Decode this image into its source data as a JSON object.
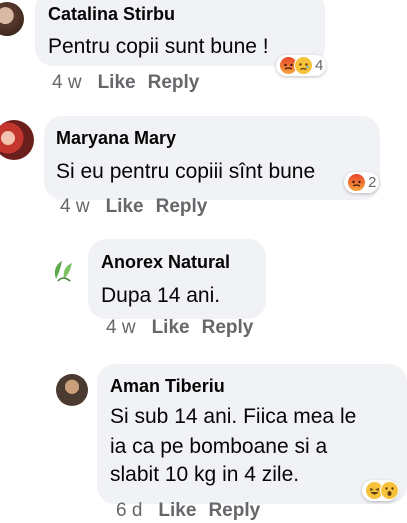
{
  "comments": [
    {
      "author": "Catalina Stirbu",
      "text_lines": [
        "Pentru copii sunt bune !"
      ],
      "time": "4 w",
      "like_label": "Like",
      "reply_label": "Reply",
      "reactions": {
        "icons": [
          "angry-icon",
          "sad-icon"
        ],
        "count": "4"
      }
    },
    {
      "author": "Maryana Mary",
      "text_lines": [
        "Si eu pentru copiii sînt bune"
      ],
      "time": "4 w",
      "like_label": "Like",
      "reply_label": "Reply",
      "reactions": {
        "icons": [
          "angry-icon"
        ],
        "count": "2"
      }
    },
    {
      "author": "Anorex Natural",
      "text_lines": [
        "Dupa 14 ani."
      ],
      "time": "4 w",
      "like_label": "Like",
      "reply_label": "Reply"
    },
    {
      "author": "Aman Tiberiu",
      "text_lines": [
        "Si sub 14 ani. Fiica mea le",
        "ia ca pe bomboane si a",
        "slabit 10 kg in 4 zile."
      ],
      "time": "6 d",
      "like_label": "Like",
      "reply_label": "Reply",
      "reactions": {
        "icons": [
          "haha-icon",
          "wow-icon"
        ]
      }
    }
  ],
  "colors": {
    "bubble": "#f0f2f5",
    "meta": "#65676b",
    "text": "#050505"
  }
}
